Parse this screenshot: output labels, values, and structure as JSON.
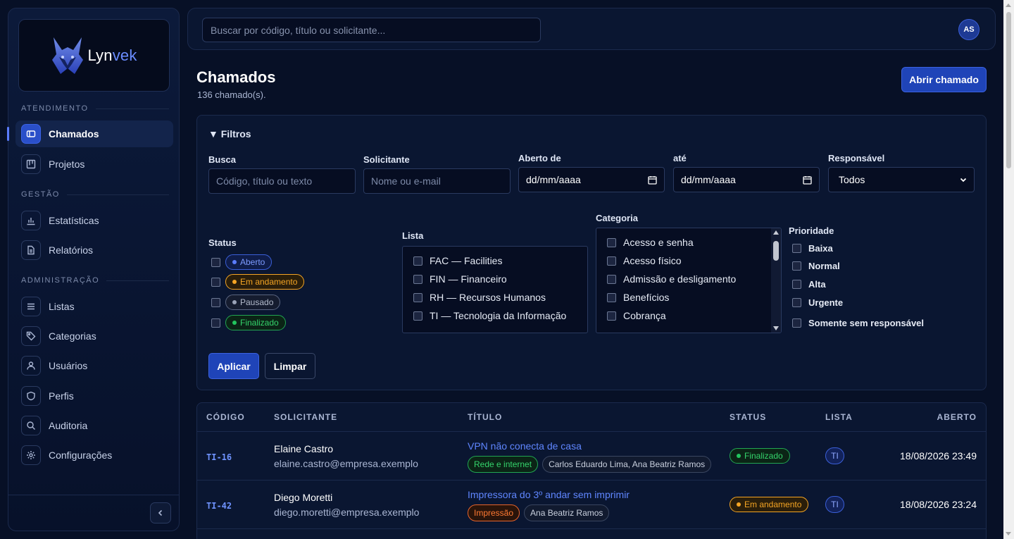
{
  "brand": {
    "name_main": "Lyn",
    "name_accent": "vek"
  },
  "sidebar": {
    "sections": [
      {
        "label": "ATENDIMENTO"
      },
      {
        "label": "GESTÃO"
      },
      {
        "label": "ADMINISTRAÇÃO"
      }
    ],
    "items": [
      {
        "label": "Chamados",
        "icon": "ticket-icon",
        "active": true
      },
      {
        "label": "Projetos",
        "icon": "kanban-icon"
      },
      {
        "label": "Estatísticas",
        "icon": "bar-chart-icon"
      },
      {
        "label": "Relatórios",
        "icon": "document-icon"
      },
      {
        "label": "Listas",
        "icon": "list-icon"
      },
      {
        "label": "Categorias",
        "icon": "tag-icon"
      },
      {
        "label": "Usuários",
        "icon": "user-icon"
      },
      {
        "label": "Perfis",
        "icon": "shield-icon"
      },
      {
        "label": "Auditoria",
        "icon": "search-icon"
      },
      {
        "label": "Configurações",
        "icon": "gear-icon"
      }
    ]
  },
  "topbar": {
    "search_placeholder": "Buscar por código, título ou solicitante...",
    "avatar_initials": "AS"
  },
  "page": {
    "title": "Chamados",
    "subtitle": "136 chamado(s).",
    "new_button": "Abrir chamado"
  },
  "filters": {
    "toggle_label": "▼ Filtros",
    "busca": {
      "label": "Busca",
      "placeholder": "Código, título ou texto"
    },
    "solicitante": {
      "label": "Solicitante",
      "placeholder": "Nome ou e-mail"
    },
    "aberto_de": {
      "label": "Aberto de",
      "value": "dd/mm/aaaa"
    },
    "ate": {
      "label": "até",
      "value": "dd/mm/aaaa"
    },
    "responsavel": {
      "label": "Responsável",
      "value": "Todos"
    },
    "status": {
      "label": "Status",
      "options": [
        {
          "label": "Aberto",
          "color": "#5b7cff"
        },
        {
          "label": "Em andamento",
          "color": "#f5a524"
        },
        {
          "label": "Pausado",
          "color": "#9aa3b8"
        },
        {
          "label": "Finalizado",
          "color": "#22c55e"
        }
      ]
    },
    "lista": {
      "label": "Lista",
      "options": [
        "FAC — Facilities",
        "FIN — Financeiro",
        "RH — Recursos Humanos",
        "TI — Tecnologia da Informação"
      ]
    },
    "categoria": {
      "label": "Categoria",
      "options": [
        "Acesso e senha",
        "Acesso físico",
        "Admissão e desligamento",
        "Benefícios",
        "Cobrança"
      ]
    },
    "prioridade": {
      "label": "Prioridade",
      "options": [
        "Baixa",
        "Normal",
        "Alta",
        "Urgente"
      ],
      "sem_responsavel": "Somente sem responsável"
    },
    "apply_label": "Aplicar",
    "clear_label": "Limpar"
  },
  "table": {
    "headers": [
      "CÓDIGO",
      "SOLICITANTE",
      "TÍTULO",
      "STATUS",
      "LISTA",
      "ABERTO"
    ],
    "rows": [
      {
        "code": "TI-16",
        "name": "Elaine Castro",
        "email": "elaine.castro@empresa.exemplo",
        "title": "VPN não conecta de casa",
        "category": "Rede e internet",
        "assignees": "Carlos Eduardo Lima, Ana Beatriz Ramos",
        "status": "Finalizado",
        "lista": "TI",
        "opened": "18/08/2026 23:49"
      },
      {
        "code": "TI-42",
        "name": "Diego Moretti",
        "email": "diego.moretti@empresa.exemplo",
        "title": "Impressora do 3º andar sem imprimir",
        "category": "Impressão",
        "assignees": "Ana Beatriz Ramos",
        "status": "Em andamento",
        "lista": "TI",
        "opened": "18/08/2026 23:24"
      }
    ]
  }
}
